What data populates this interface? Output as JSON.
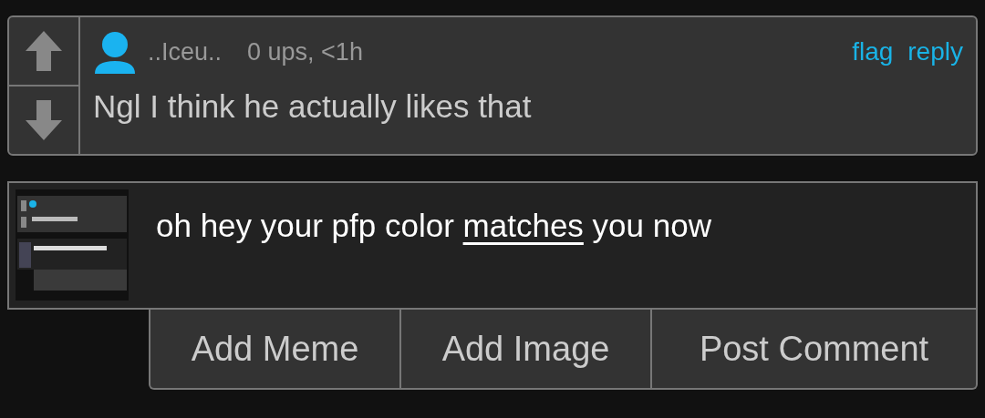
{
  "comment": {
    "username": "..Iceu..",
    "meta": "0 ups, <1h",
    "actions": [
      "flag",
      "reply"
    ],
    "text": "Ngl I think he actually likes that"
  },
  "reply_box": {
    "value": [
      {
        "text": "oh hey your pfp color ",
        "underlined": false
      },
      {
        "text": "matches",
        "underlined": true
      },
      {
        "text": " you now",
        "underlined": false
      }
    ],
    "buttons": [
      "Add Meme",
      "Add Image",
      "Post Comment"
    ]
  }
}
